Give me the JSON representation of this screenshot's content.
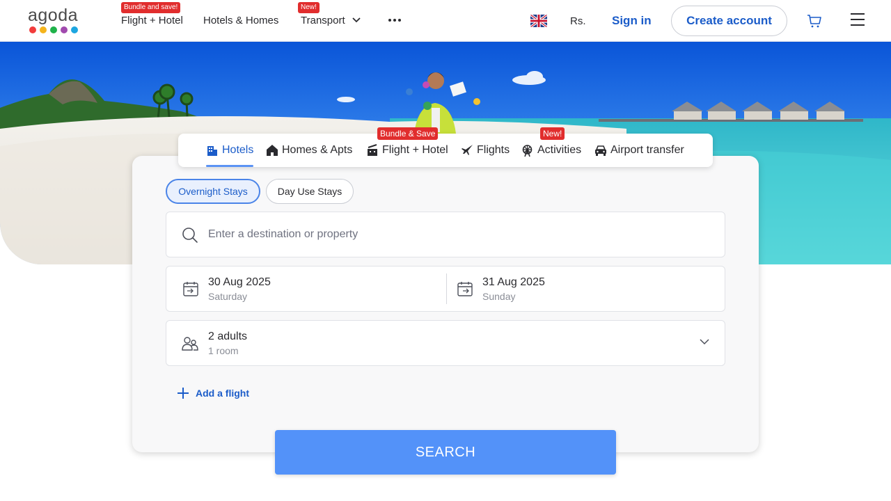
{
  "brand": {
    "logo_text": "agoda",
    "dot_colors": [
      "#f23c3c",
      "#f5b41c",
      "#1fb24a",
      "#a14aae",
      "#1da6e0"
    ]
  },
  "nav": {
    "items": [
      {
        "label": "Flight + Hotel",
        "badge": "Bundle and save!"
      },
      {
        "label": "Hotels & Homes",
        "badge": ""
      },
      {
        "label": "Transport",
        "badge": "New!"
      }
    ],
    "currency": "Rs.",
    "sign_in": "Sign in",
    "create_account": "Create account"
  },
  "tabs": [
    {
      "label": "Hotels",
      "badge": "",
      "active": true
    },
    {
      "label": "Homes & Apts",
      "badge": ""
    },
    {
      "label": "Flight + Hotel",
      "badge": "Bundle & Save"
    },
    {
      "label": "Flights",
      "badge": ""
    },
    {
      "label": "Activities",
      "badge": "New!"
    },
    {
      "label": "Airport transfer",
      "badge": ""
    }
  ],
  "stay_types": {
    "overnight": "Overnight Stays",
    "day_use": "Day Use Stays",
    "selected": "Overnight Stays"
  },
  "search": {
    "placeholder": "Enter a destination or property"
  },
  "dates": {
    "check_in": {
      "date": "30 Aug 2025",
      "day": "Saturday"
    },
    "check_out": {
      "date": "31 Aug 2025",
      "day": "Sunday"
    }
  },
  "guests": {
    "summary": "2 adults",
    "rooms": "1 room"
  },
  "add_flight": "Add a flight",
  "search_button": "SEARCH",
  "colors": {
    "primary_blue": "#5392f9",
    "link_blue": "#1b5cc9",
    "badge_red": "#e12d2d"
  }
}
